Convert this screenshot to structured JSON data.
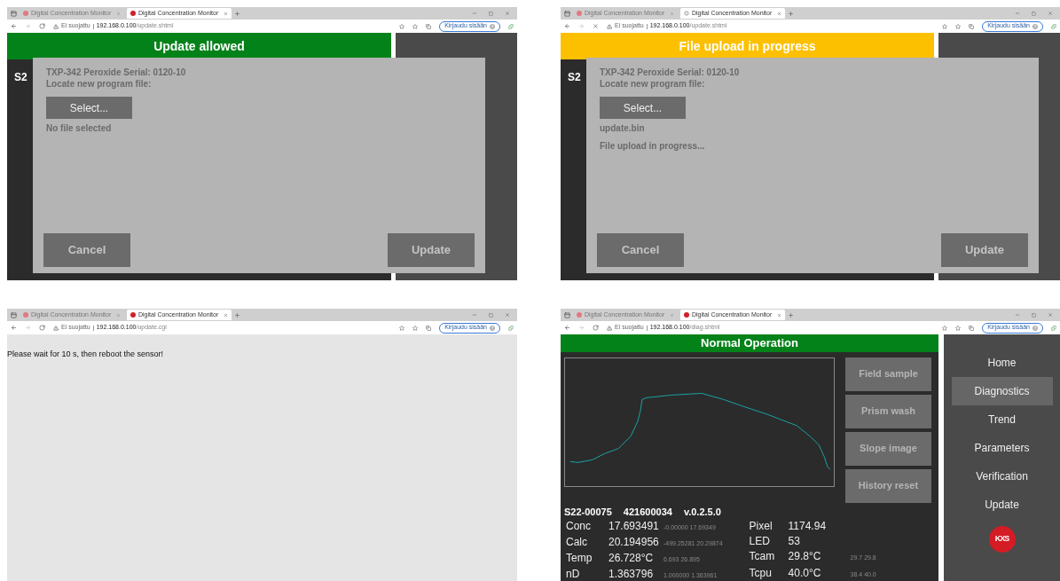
{
  "windows": [
    {
      "tabs": [
        {
          "title": "Digital Concentration Monitor",
          "selected": false,
          "loading": false
        },
        {
          "title": "Digital Concentration Monitor",
          "selected": true,
          "loading": false
        }
      ],
      "address": {
        "security": "Ei suojattu",
        "host": "192.168.0.100",
        "path": "/update.shtml"
      },
      "sign_in": "Kirjaudu sisään",
      "content": {
        "kind": "dialog",
        "banner": {
          "text": "Update allowed",
          "color": "#038219"
        },
        "behind_text": "S2",
        "dialog": {
          "device": "TXP-342 Peroxide Serial: 0120-10",
          "prompt": "Locate new program file:",
          "select_button": "Select...",
          "file": "No file selected",
          "cancel": "Cancel",
          "update": "Update"
        }
      }
    },
    {
      "tabs": [
        {
          "title": "Digital Concentration Monitor",
          "selected": false,
          "loading": false
        },
        {
          "title": "Digital Concentration Monitor",
          "selected": true,
          "loading": true
        }
      ],
      "address": {
        "security": "Ei suojattu",
        "host": "192.168.0.100",
        "path": "/update.shtml"
      },
      "sign_in": "Kirjaudu sisään",
      "content": {
        "kind": "dialog",
        "banner": {
          "text": "File upload in progress",
          "color": "#fdc000"
        },
        "behind_text": "S2",
        "dialog": {
          "device": "TXP-342 Peroxide Serial: 0120-10",
          "prompt": "Locate new program file:",
          "select_button": "Select...",
          "file": "update.bin",
          "progress": "File upload in progress...",
          "cancel": "Cancel",
          "update": "Update"
        }
      }
    },
    {
      "tabs": [
        {
          "title": "Digital Concentration Monitor",
          "selected": false,
          "loading": false
        },
        {
          "title": "Digital Concentration Monitor",
          "selected": true,
          "loading": false
        }
      ],
      "address": {
        "security": "Ei suojattu",
        "host": "192.168.0.100",
        "path": "/update.cgi"
      },
      "sign_in": "Kirjaudu sisään",
      "content": {
        "kind": "message",
        "text": "Please wait for 10 s, then reboot the sensor!"
      }
    },
    {
      "tabs": [
        {
          "title": "Digital Concentration Monitor",
          "selected": false,
          "loading": false
        },
        {
          "title": "Digital Concentration Monitor",
          "selected": true,
          "loading": false
        }
      ],
      "address": {
        "security": "Ei suojattu",
        "host": "192.168.0.100",
        "path": "/diag.shtml"
      },
      "sign_in": "Kirjaudu sisään",
      "content": {
        "kind": "diagnostics",
        "banner": {
          "text": "Normal Operation",
          "color": "#038219"
        },
        "actions": [
          "Field sample",
          "Prism wash",
          "Slope image",
          "History reset"
        ],
        "header": [
          "S22-00075",
          "421600034",
          "v.0.2.5.0"
        ],
        "readings": [
          {
            "label": "Conc",
            "value": "17.693491",
            "range": "-0.00000 17.69349"
          },
          {
            "label": "Calc",
            "value": "20.194956",
            "range": "-499.25281 20.29874"
          },
          {
            "label": "Temp",
            "value": "26.728°C",
            "range": "6.693 26.895"
          },
          {
            "label": "nD",
            "value": "1.363796",
            "range": "1.000000 1.363961"
          }
        ],
        "readings_right": [
          {
            "label": "Pixel",
            "value": "1174.94"
          },
          {
            "label": "LED",
            "value": "53"
          },
          {
            "label": "Tcam",
            "value": "29.8°C",
            "range": "29.7 29.8"
          },
          {
            "label": "Tcpu",
            "value": "40.0°C",
            "range": "38.4 40.0"
          }
        ],
        "nav": [
          {
            "label": "Home",
            "selected": false
          },
          {
            "label": "Diagnostics",
            "selected": true
          },
          {
            "label": "Trend",
            "selected": false
          },
          {
            "label": "Parameters",
            "selected": false
          },
          {
            "label": "Verification",
            "selected": false
          },
          {
            "label": "Update",
            "selected": false
          }
        ],
        "logo": "KXS"
      }
    }
  ]
}
